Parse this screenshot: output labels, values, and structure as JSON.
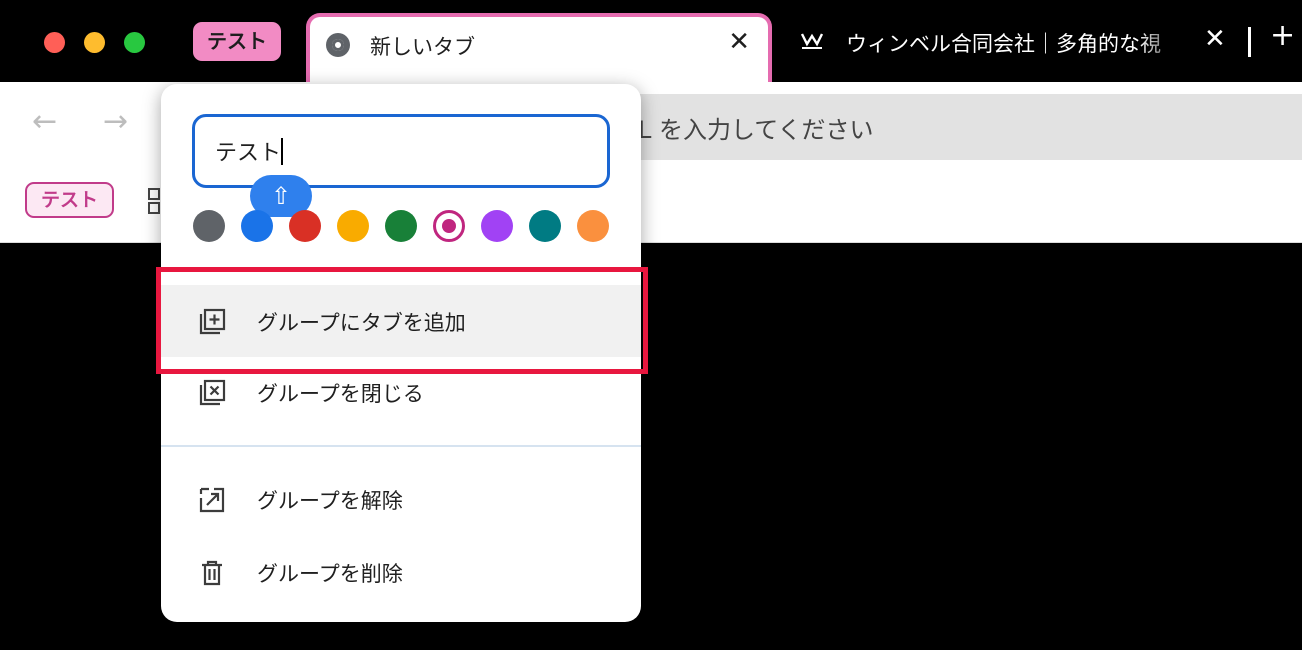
{
  "tabstrip": {
    "group_label": "テスト",
    "active_tab": {
      "title": "新しいタブ",
      "close": "✕"
    },
    "other_tab": {
      "favicon_text": "ᴡ",
      "title": "ウィンベル合同会社｜多角的な視",
      "close": "✕"
    },
    "new_tab": "+"
  },
  "toolbar": {
    "back": "←",
    "forward": "→",
    "omnibox_visible_text": "L を入力してください"
  },
  "bookmarks": {
    "group_chip": "テスト"
  },
  "group_editor": {
    "name_value": "テスト",
    "ime_icon": "⇧",
    "colors": [
      {
        "name": "grey",
        "hex": "#5f6368"
      },
      {
        "name": "blue",
        "hex": "#1a73e8"
      },
      {
        "name": "red",
        "hex": "#d93025"
      },
      {
        "name": "yellow",
        "hex": "#f9ab00"
      },
      {
        "name": "green",
        "hex": "#188038"
      },
      {
        "name": "pink",
        "hex": "#c0267f",
        "selected": true
      },
      {
        "name": "purple",
        "hex": "#a142f4"
      },
      {
        "name": "cyan",
        "hex": "#007b83"
      },
      {
        "name": "orange",
        "hex": "#fa903e"
      }
    ],
    "menu": [
      {
        "id": "add-tab",
        "label": "グループにタブを追加",
        "icon": "add-tab-icon"
      },
      {
        "id": "close-group",
        "label": "グループを閉じる",
        "icon": "close-group-icon"
      },
      {
        "id": "ungroup",
        "label": "グループを解除",
        "icon": "ungroup-icon"
      },
      {
        "id": "delete-group",
        "label": "グループを削除",
        "icon": "trash-icon"
      }
    ]
  },
  "annotation": {
    "highlight_color": "#e8173f"
  }
}
